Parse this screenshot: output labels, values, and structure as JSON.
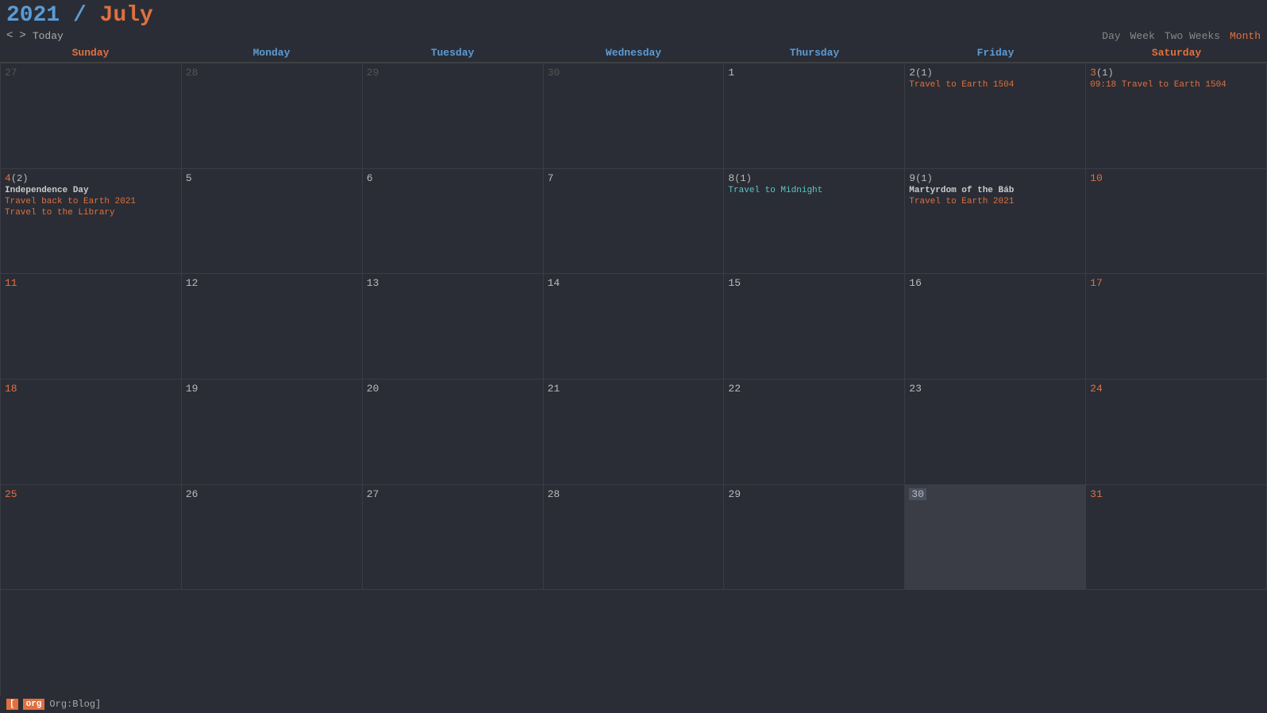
{
  "header": {
    "year": "2021",
    "separator": " / ",
    "month": "July",
    "nav": {
      "prev": "<",
      "next": ">",
      "today": "Today"
    },
    "views": [
      "Day",
      "Week",
      "Two Weeks",
      "Month"
    ],
    "active_view": "Month"
  },
  "day_headers": [
    {
      "label": "Sunday",
      "type": "weekend"
    },
    {
      "label": "Monday",
      "type": "weekday"
    },
    {
      "label": "Tuesday",
      "type": "weekday"
    },
    {
      "label": "Wednesday",
      "type": "weekday"
    },
    {
      "label": "Thursday",
      "type": "weekday"
    },
    {
      "label": "Friday",
      "type": "weekday"
    },
    {
      "label": "Saturday",
      "type": "weekend"
    }
  ],
  "weeks": [
    [
      {
        "day": "27",
        "other_month": true,
        "events": []
      },
      {
        "day": "28",
        "other_month": true,
        "events": []
      },
      {
        "day": "29",
        "other_month": true,
        "events": []
      },
      {
        "day": "30",
        "other_month": true,
        "events": []
      },
      {
        "day": "1",
        "other_month": false,
        "events": []
      },
      {
        "day": "2",
        "other_month": false,
        "count": "(1)",
        "events": [
          {
            "text": "Travel to Earth 1504",
            "style": "orange"
          }
        ]
      },
      {
        "day": "3",
        "other_month": false,
        "count": "(1)",
        "day_style": "saturday",
        "events": [
          {
            "text": "09:18 Travel to Earth 1504",
            "style": "orange"
          }
        ]
      }
    ],
    [
      {
        "day": "4",
        "other_month": false,
        "count": "(2)",
        "day_style": "sunday",
        "events": [
          {
            "text": "Independence Day",
            "style": "bold"
          },
          {
            "text": "Travel back to Earth 2021",
            "style": "orange"
          },
          {
            "text": "Travel to the Library",
            "style": "orange"
          }
        ]
      },
      {
        "day": "5",
        "other_month": false,
        "events": []
      },
      {
        "day": "6",
        "other_month": false,
        "events": []
      },
      {
        "day": "7",
        "other_month": false,
        "events": []
      },
      {
        "day": "8",
        "other_month": false,
        "count": "(1)",
        "events": [
          {
            "text": "Travel to Midnight",
            "style": "cyan"
          }
        ]
      },
      {
        "day": "9",
        "other_month": false,
        "count": "(1)",
        "events": [
          {
            "text": "Martyrdom of the Báb",
            "style": "bold"
          },
          {
            "text": "Travel to Earth 2021",
            "style": "orange"
          }
        ]
      },
      {
        "day": "10",
        "other_month": false,
        "day_style": "saturday",
        "events": []
      }
    ],
    [
      {
        "day": "11",
        "other_month": false,
        "day_style": "sunday",
        "events": []
      },
      {
        "day": "12",
        "other_month": false,
        "events": []
      },
      {
        "day": "13",
        "other_month": false,
        "events": []
      },
      {
        "day": "14",
        "other_month": false,
        "events": []
      },
      {
        "day": "15",
        "other_month": false,
        "events": []
      },
      {
        "day": "16",
        "other_month": false,
        "events": []
      },
      {
        "day": "17",
        "other_month": false,
        "day_style": "saturday",
        "events": []
      }
    ],
    [
      {
        "day": "18",
        "other_month": false,
        "day_style": "sunday",
        "events": []
      },
      {
        "day": "19",
        "other_month": false,
        "events": []
      },
      {
        "day": "20",
        "other_month": false,
        "events": []
      },
      {
        "day": "21",
        "other_month": false,
        "events": []
      },
      {
        "day": "22",
        "other_month": false,
        "events": []
      },
      {
        "day": "23",
        "other_month": false,
        "events": []
      },
      {
        "day": "24",
        "other_month": false,
        "day_style": "saturday",
        "events": []
      }
    ],
    [
      {
        "day": "25",
        "other_month": false,
        "day_style": "sunday",
        "events": []
      },
      {
        "day": "26",
        "other_month": false,
        "events": []
      },
      {
        "day": "27",
        "other_month": false,
        "events": []
      },
      {
        "day": "28",
        "other_month": false,
        "events": []
      },
      {
        "day": "29",
        "other_month": false,
        "events": []
      },
      {
        "day": "30",
        "other_month": false,
        "is_today": true,
        "events": []
      },
      {
        "day": "31",
        "other_month": false,
        "day_style": "saturday",
        "events": []
      }
    ]
  ],
  "footer": {
    "tag": "org",
    "label": "Org:Blog]"
  }
}
